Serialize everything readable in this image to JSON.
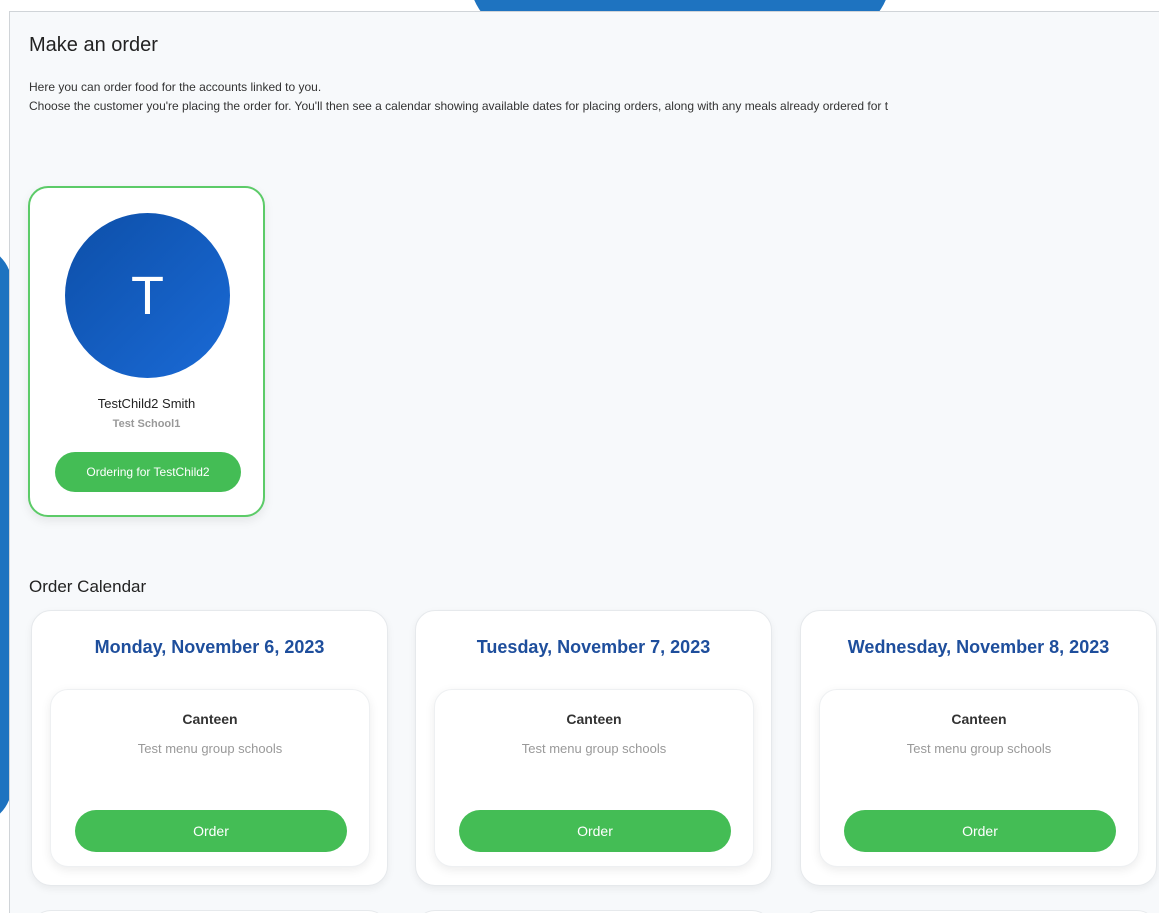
{
  "page": {
    "title": "Make an order",
    "intro_line1": "Here you can order food for the accounts linked to you.",
    "intro_line2": "Choose the customer you're placing the order for. You'll then see a calendar showing available dates for placing orders, along with any meals already ordered for t"
  },
  "customer": {
    "initial": "T",
    "name": "TestChild2 Smith",
    "school": "Test School1",
    "button_label": "Ordering for TestChild2"
  },
  "calendar": {
    "title": "Order Calendar",
    "days": [
      {
        "date": "Monday, November 6, 2023",
        "menu_name": "Canteen",
        "menu_group": "Test menu group schools",
        "button_label": "Order"
      },
      {
        "date": "Tuesday, November 7, 2023",
        "menu_name": "Canteen",
        "menu_group": "Test menu group schools",
        "button_label": "Order"
      },
      {
        "date": "Wednesday, November 8, 2023",
        "menu_name": "Canteen",
        "menu_group": "Test menu group schools",
        "button_label": "Order"
      }
    ]
  },
  "colors": {
    "accent_green": "#44bd55",
    "date_blue": "#1e4e9c",
    "avatar_blue": "#1a6ad6",
    "background_blue": "#1e73c0"
  }
}
